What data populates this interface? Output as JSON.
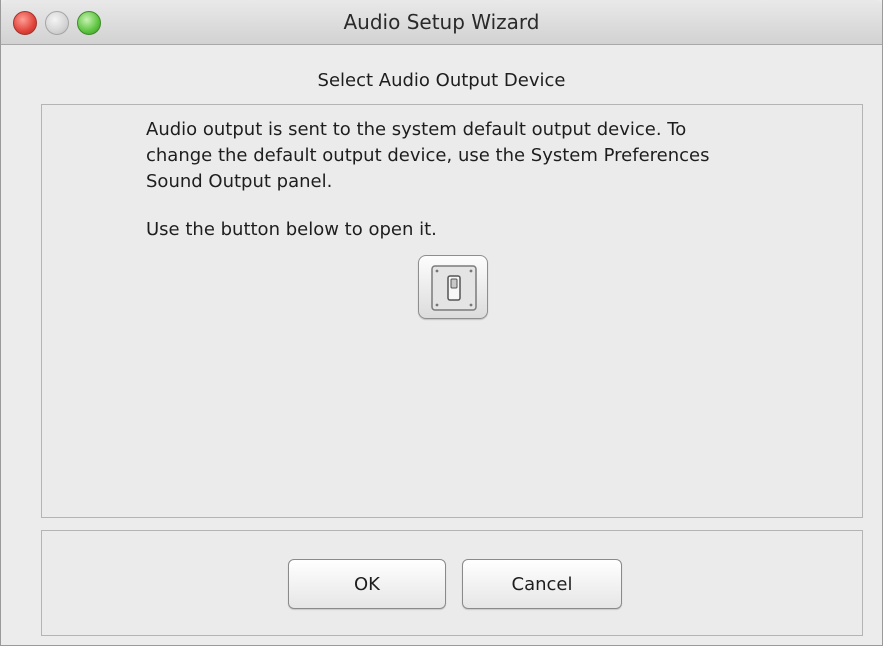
{
  "window": {
    "title": "Audio Setup Wizard",
    "controls": [
      "close-icon",
      "minimize-icon",
      "zoom-icon"
    ]
  },
  "heading": "Select Audio Output Device",
  "main": {
    "description": "Audio output is sent to the system default output device. To\nchange the default output device, use the System Preferences\n Sound Output panel.",
    "hint": "Use the button below to open it.",
    "open_prefs_button_icon": "system-preferences-icon"
  },
  "footer": {
    "ok_label": "OK",
    "cancel_label": "Cancel"
  },
  "colors": {
    "close": "#e0443a",
    "minimize": "#d4d4d4",
    "zoom": "#5cc43f",
    "background": "#ececec"
  }
}
